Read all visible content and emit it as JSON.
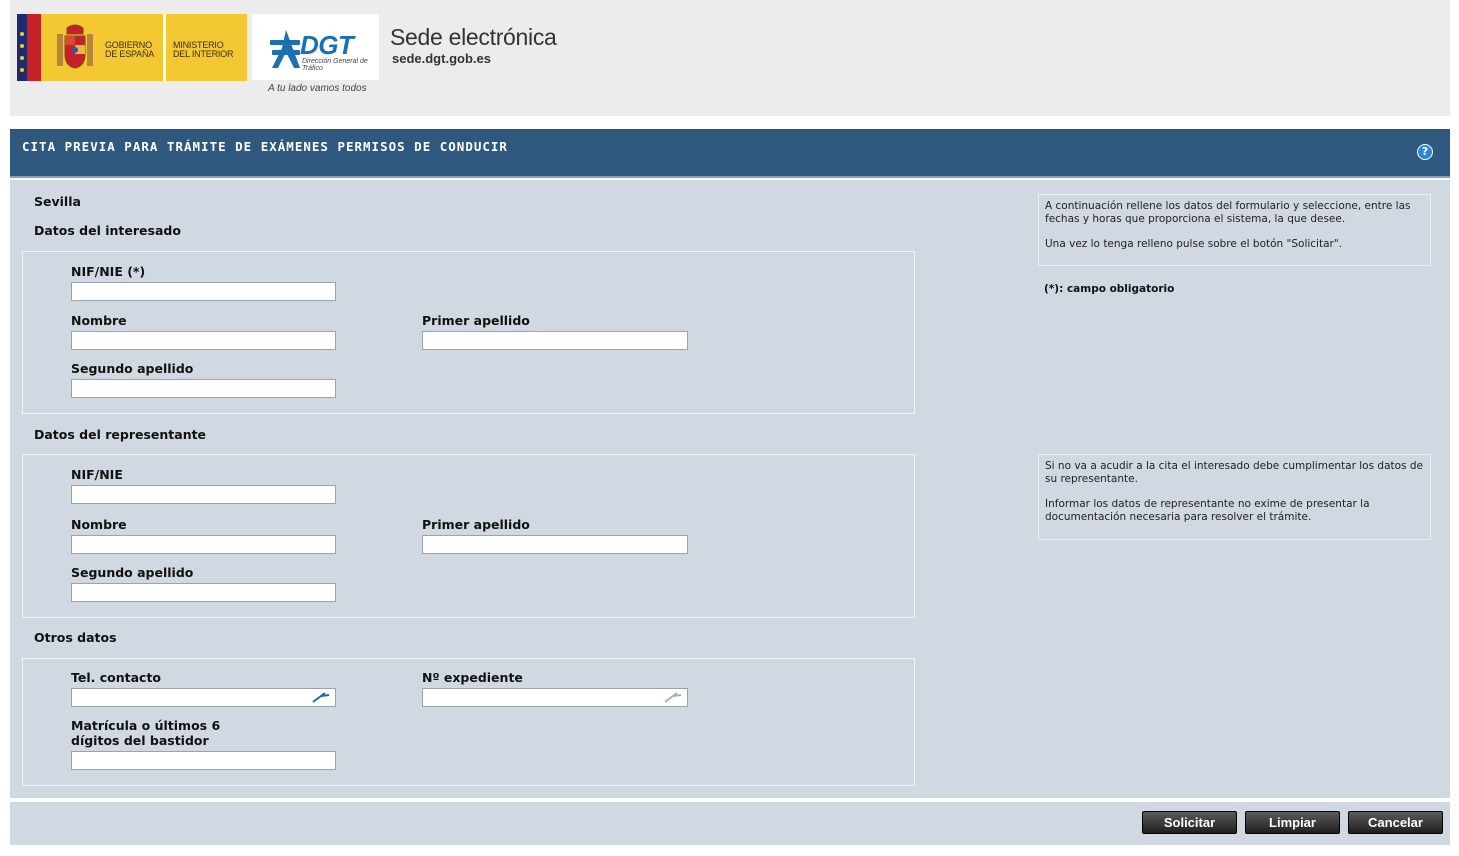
{
  "header": {
    "gov_line1": "GOBIERNO",
    "gov_line2": "DE ESPAÑA",
    "ministry_line1": "MINISTERIO",
    "ministry_line2": "DEL INTERIOR",
    "dgt_logo": "DGT",
    "dgt_sub": "Dirección General de Tráfico",
    "dgt_tagline": "A tu lado vamos todos",
    "site_title": "Sede electrónica",
    "site_url": "sede.dgt.gob.es"
  },
  "titlebar": {
    "title": "CITA PREVIA PARA TRÁMITE DE EXÁMENES PERMISOS DE CONDUCIR",
    "help_icon": "help-icon"
  },
  "form": {
    "office": "Sevilla",
    "interesado": {
      "section_title": "Datos del interesado",
      "nif_label": "NIF/NIE (*)",
      "nif_value": "",
      "nombre_label": "Nombre",
      "nombre_value": "",
      "apellido1_label": "Primer apellido",
      "apellido1_value": "",
      "apellido2_label": "Segundo apellido",
      "apellido2_value": ""
    },
    "representante": {
      "section_title": "Datos del representante",
      "nif_label": "NIF/NIE",
      "nif_value": "",
      "nombre_label": "Nombre",
      "nombre_value": "",
      "apellido1_label": "Primer apellido",
      "apellido1_value": "",
      "apellido2_label": "Segundo apellido",
      "apellido2_value": ""
    },
    "otros": {
      "section_title": "Otros datos",
      "tel_label": "Tel. contacto",
      "tel_value": "",
      "expediente_label": "Nº expediente",
      "expediente_value": "",
      "matricula_label_line1": "Matrícula o últimos 6",
      "matricula_label_line2": "dígitos del bastidor",
      "matricula_value": ""
    }
  },
  "info": {
    "box1_p1": "A continuación rellene los datos del formulario y seleccione, entre las fechas y horas que proporciona el sistema, la que desee.",
    "box1_p2": "Una vez lo tenga relleno pulse sobre el botón \"Solicitar\".",
    "required_note": "(*): campo obligatorio",
    "box2_p1": "Si no va a acudir a la cita el interesado debe cumplimentar los datos de su representante.",
    "box2_p2": "Informar los datos de representante no exime de presentar la documentación necesaria para resolver el trámite."
  },
  "buttons": {
    "solicitar": "Solicitar",
    "limpiar": "Limpiar",
    "cancelar": "Cancelar"
  }
}
